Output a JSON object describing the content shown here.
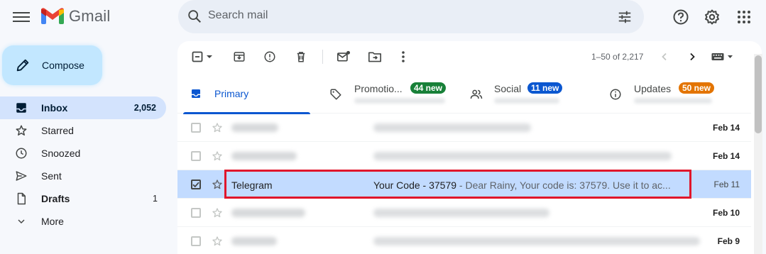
{
  "header": {
    "app_name": "Gmail",
    "search_placeholder": "Search mail"
  },
  "compose": {
    "label": "Compose"
  },
  "sidebar": {
    "items": [
      {
        "label": "Inbox",
        "count": "2,052",
        "icon": "inbox-icon",
        "active": true
      },
      {
        "label": "Starred",
        "count": "",
        "icon": "star-icon"
      },
      {
        "label": "Snoozed",
        "count": "",
        "icon": "clock-icon"
      },
      {
        "label": "Sent",
        "count": "",
        "icon": "send-icon"
      },
      {
        "label": "Drafts",
        "count": "1",
        "icon": "draft-icon"
      },
      {
        "label": "More",
        "count": "",
        "icon": "chevron-down-icon"
      }
    ]
  },
  "toolbar": {
    "pagination": "1–50 of 2,217"
  },
  "tabs": [
    {
      "label": "Primary",
      "badge": ""
    },
    {
      "label": "Promotio...",
      "badge": "44 new",
      "badge_color": "#188038"
    },
    {
      "label": "Social",
      "badge": "11 new",
      "badge_color": "#0b57d0"
    },
    {
      "label": "Updates",
      "badge": "50 new",
      "badge_color": "#e37400"
    }
  ],
  "emails": [
    {
      "sender": "",
      "subject": "",
      "snippet": "",
      "date": "Feb 14",
      "selected": false
    },
    {
      "sender": "",
      "subject": "",
      "snippet": "",
      "date": "Feb 14",
      "selected": false
    },
    {
      "sender": "Telegram",
      "subject": "Your Code - 37579",
      "snippet": " - Dear Rainy, Your code is: 37579. Use it to ac...",
      "date": "Feb 11",
      "selected": true
    },
    {
      "sender": "",
      "subject": "",
      "snippet": "",
      "date": "Feb 10",
      "selected": false
    },
    {
      "sender": "",
      "subject": "",
      "snippet": "",
      "date": "Feb 9",
      "selected": false
    }
  ],
  "colors": {
    "accent": "#0b57d0",
    "compose_bg": "#c2e7ff",
    "selected_row": "#c2dbff",
    "highlight_border": "#e0162b"
  }
}
